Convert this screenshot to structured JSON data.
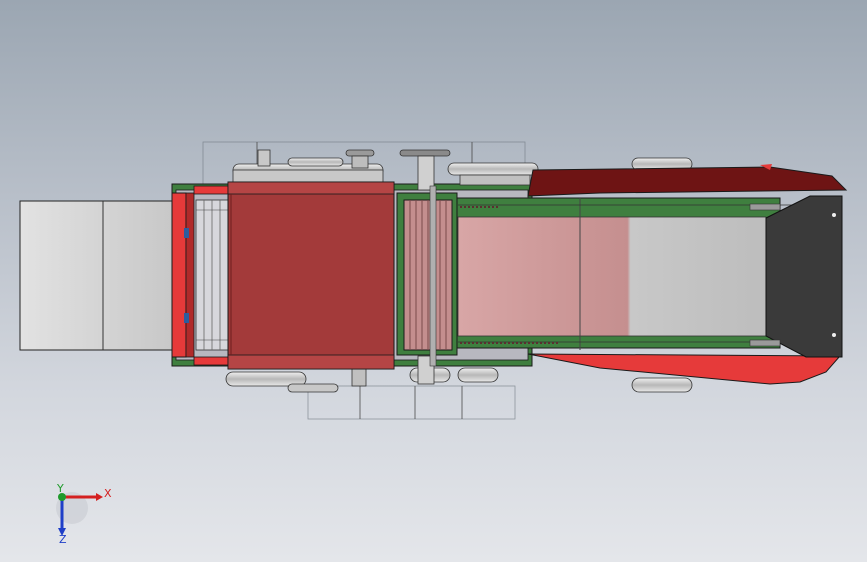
{
  "viewport": {
    "background_top": "#9ba6b2",
    "background_bottom": "#e4e6ea"
  },
  "triad": {
    "x_label": "X",
    "y_label": "Y",
    "z_label": "Z",
    "x_color": "#d42020",
    "y_color": "#1f9a2b",
    "z_color": "#1f3fc8"
  },
  "model": {
    "name": "",
    "colors": {
      "hopper_red": "#a33a3a",
      "frame_red": "#e63a3a",
      "frame_green": "#3f7f3f",
      "cover_dark_red": "#6e1414",
      "hood_dark": "#3a3a3a",
      "bin_grey": "#d8d8d8",
      "belt_pink": "#c99797"
    }
  }
}
